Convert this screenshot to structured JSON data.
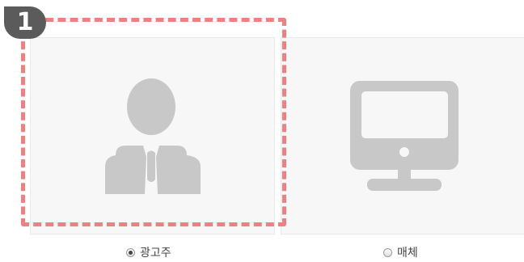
{
  "step_badge": "1",
  "options": [
    {
      "label": "광고주",
      "icon": "person-icon",
      "selected": true
    },
    {
      "label": "매체",
      "icon": "monitor-icon",
      "selected": false
    }
  ],
  "colors": {
    "highlight": "#f08080",
    "badge": "#5b5b5b",
    "icon": "#c8c8c8",
    "card_bg": "#f7f7f7"
  }
}
